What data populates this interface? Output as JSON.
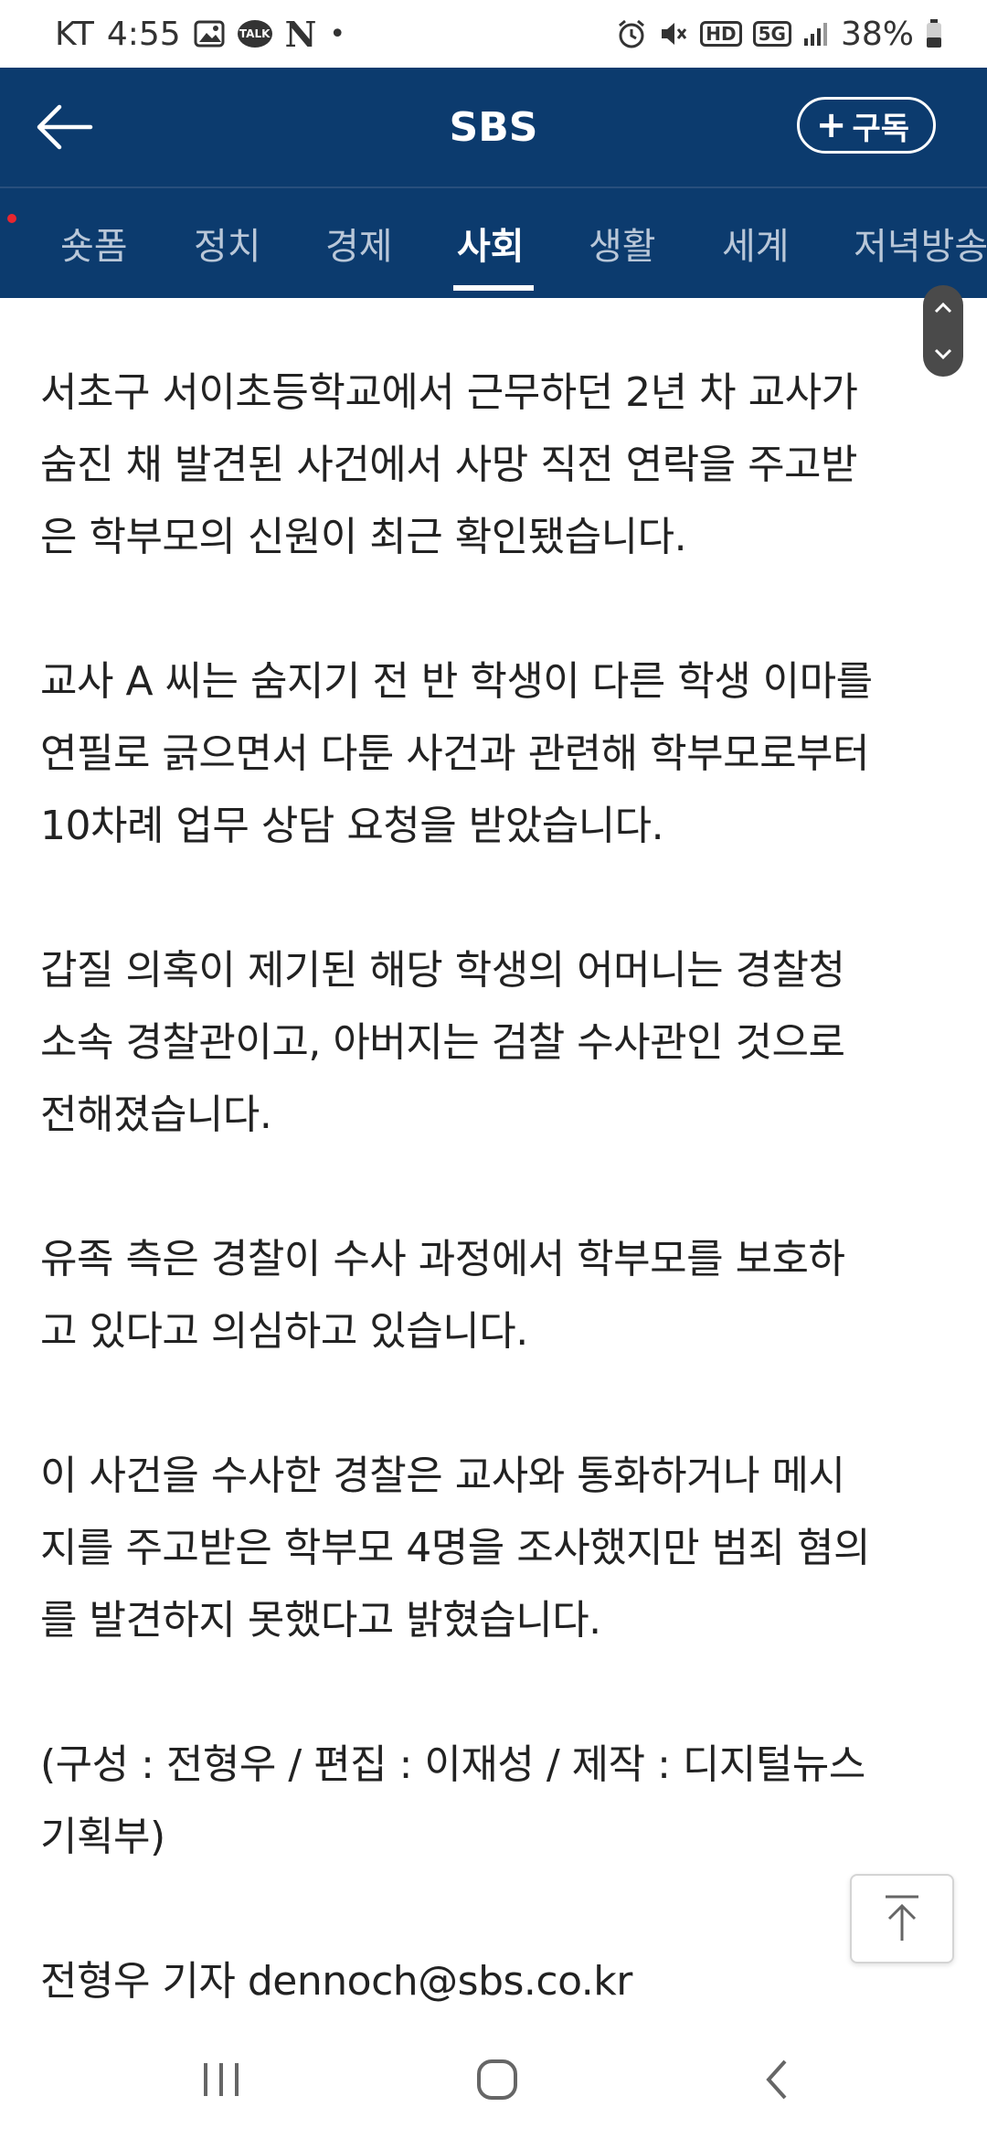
{
  "status_bar": {
    "carrier": "KT",
    "time": "4:55",
    "talk_label": "TALK",
    "n_label": "N",
    "dot": "•",
    "hd_label": "HD",
    "network": "5G",
    "battery": "38%",
    "icons": [
      "gallery-icon",
      "kakaotalk-icon",
      "naver-icon",
      "alarm-icon",
      "mute-icon",
      "hd-voice-icon",
      "5g-icon",
      "signal-icon",
      "battery-icon"
    ]
  },
  "header": {
    "title": "SBS",
    "subscribe_label": "구독",
    "subscribe_plus": "+",
    "bg_color": "#0c3b6e"
  },
  "tabs": {
    "items": [
      {
        "label": "숏폼",
        "active": false
      },
      {
        "label": "정치",
        "active": false
      },
      {
        "label": "경제",
        "active": false
      },
      {
        "label": "사회",
        "active": true
      },
      {
        "label": "생활",
        "active": false
      },
      {
        "label": "세계",
        "active": false
      },
      {
        "label": "저녁방송",
        "active": false
      }
    ]
  },
  "article": {
    "paragraphs": [
      "서초구 서이초등학교에서 근무하던 2년 차 교사가\n숨진 채 발견된 사건에서 사망 직전 연락을 주고받\n은 학부모의 신원이 최근 확인됐습니다.",
      "교사 A 씨는 숨지기 전 반 학생이 다른 학생 이마를\n연필로 긁으면서 다툰 사건과 관련해 학부모로부터\n10차례 업무 상담 요청을 받았습니다.",
      "갑질 의혹이 제기된 해당 학생의 어머니는 경찰청\n소속 경찰관이고, 아버지는 검찰 수사관인 것으로\n전해졌습니다.",
      "유족 측은 경찰이 수사 과정에서 학부모를 보호하\n고 있다고 의심하고 있습니다.",
      "이 사건을 수사한 경찰은 교사와 통화하거나 메시\n지를 주고받은 학부모 4명을 조사했지만 범죄 혐의\n를 발견하지 못했다고 밝혔습니다.",
      "(구성 : 전형우 / 편집 : 이재성 / 제작 : 디지털뉴스\n기획부)"
    ],
    "reporter_line": "전형우 기자 dennoch@sbs.co.kr"
  },
  "controls": {
    "scroll_top": "scroll-to-top-icon"
  },
  "nav_bar": {
    "icons": [
      "recent-apps-icon",
      "home-icon",
      "back-icon"
    ]
  }
}
